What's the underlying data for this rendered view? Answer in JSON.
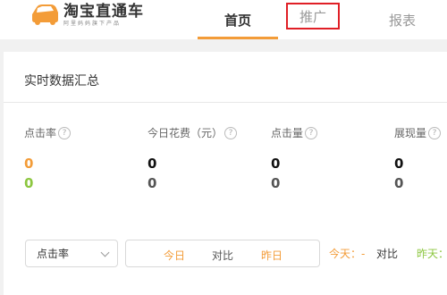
{
  "header": {
    "logo_title": "淘宝直通车",
    "logo_subtitle": "阿里妈妈旗下产品",
    "nav": [
      "首页",
      "推广",
      "报表"
    ]
  },
  "card": {
    "title": "实时数据汇总",
    "metrics": [
      {
        "label": "点击率",
        "today": "0",
        "yesterday": "0"
      },
      {
        "label": "今日花费（元）",
        "today": "0",
        "yesterday": "0"
      },
      {
        "label": "点击量",
        "today": "0",
        "yesterday": "0"
      },
      {
        "label": "展现量",
        "today": "0",
        "yesterday": "0"
      }
    ],
    "help_glyph": "?",
    "select_value": "点击率",
    "segment": [
      "今日",
      "对比",
      "昨日"
    ],
    "legend": {
      "today": "今天：-",
      "compare": "对比",
      "yesterday": "昨天："
    }
  },
  "colors": {
    "accent": "#f39c38",
    "today_value": "#f39c38",
    "yesterday_value": "#8cc63f",
    "highlight_border": "#e01f26"
  }
}
